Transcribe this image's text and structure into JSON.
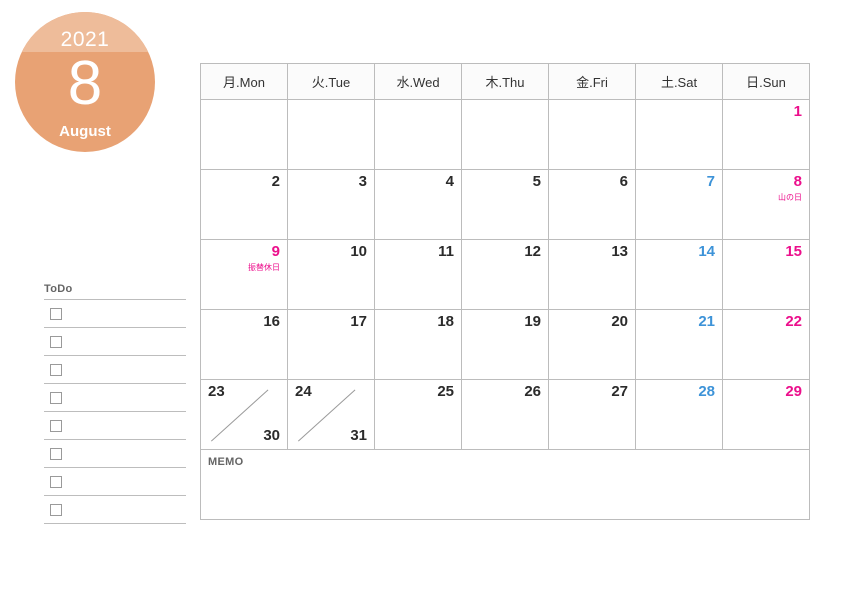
{
  "badge": {
    "year": "2021",
    "month_number": "8",
    "month_name": "August",
    "color_light": "#eebc9a",
    "color_dark": "#e8a274"
  },
  "todo": {
    "title": "ToDo",
    "row_count": 8
  },
  "calendar": {
    "headers": [
      {
        "label": "月.Mon",
        "type": "weekday"
      },
      {
        "label": "火.Tue",
        "type": "weekday"
      },
      {
        "label": "水.Wed",
        "type": "weekday"
      },
      {
        "label": "木.Thu",
        "type": "weekday"
      },
      {
        "label": "金.Fri",
        "type": "weekday"
      },
      {
        "label": "土.Sat",
        "type": "sat"
      },
      {
        "label": "日.Sun",
        "type": "sun"
      }
    ],
    "weeks": [
      [
        {
          "num": "",
          "type": "empty"
        },
        {
          "num": "",
          "type": "empty"
        },
        {
          "num": "",
          "type": "empty"
        },
        {
          "num": "",
          "type": "empty"
        },
        {
          "num": "",
          "type": "empty"
        },
        {
          "num": "",
          "type": "empty"
        },
        {
          "num": "1",
          "type": "sun"
        }
      ],
      [
        {
          "num": "2",
          "type": "weekday"
        },
        {
          "num": "3",
          "type": "weekday"
        },
        {
          "num": "4",
          "type": "weekday"
        },
        {
          "num": "5",
          "type": "weekday"
        },
        {
          "num": "6",
          "type": "weekday"
        },
        {
          "num": "7",
          "type": "sat"
        },
        {
          "num": "8",
          "type": "sun",
          "holiday": "山の日"
        }
      ],
      [
        {
          "num": "9",
          "type": "sun",
          "holiday": "振替休日"
        },
        {
          "num": "10",
          "type": "weekday"
        },
        {
          "num": "11",
          "type": "weekday"
        },
        {
          "num": "12",
          "type": "weekday"
        },
        {
          "num": "13",
          "type": "weekday"
        },
        {
          "num": "14",
          "type": "sat"
        },
        {
          "num": "15",
          "type": "sun"
        }
      ],
      [
        {
          "num": "16",
          "type": "weekday"
        },
        {
          "num": "17",
          "type": "weekday"
        },
        {
          "num": "18",
          "type": "weekday"
        },
        {
          "num": "19",
          "type": "weekday"
        },
        {
          "num": "20",
          "type": "weekday"
        },
        {
          "num": "21",
          "type": "sat"
        },
        {
          "num": "22",
          "type": "sun"
        }
      ],
      [
        {
          "num": "23",
          "num2": "30",
          "type": "split"
        },
        {
          "num": "24",
          "num2": "31",
          "type": "split"
        },
        {
          "num": "25",
          "type": "weekday"
        },
        {
          "num": "26",
          "type": "weekday"
        },
        {
          "num": "27",
          "type": "weekday"
        },
        {
          "num": "28",
          "type": "sat"
        },
        {
          "num": "29",
          "type": "sun"
        }
      ]
    ],
    "memo_label": "MEMO"
  },
  "colors": {
    "sat_text": "#3d93d8",
    "sun_text": "#ec0f8c",
    "sun_header_text": "#e8404a",
    "sat_header_bg": "#e3eff6",
    "sun_header_bg": "#fbe6e8",
    "grid_border": "#bcbcbc",
    "muted_text": "#656565"
  }
}
